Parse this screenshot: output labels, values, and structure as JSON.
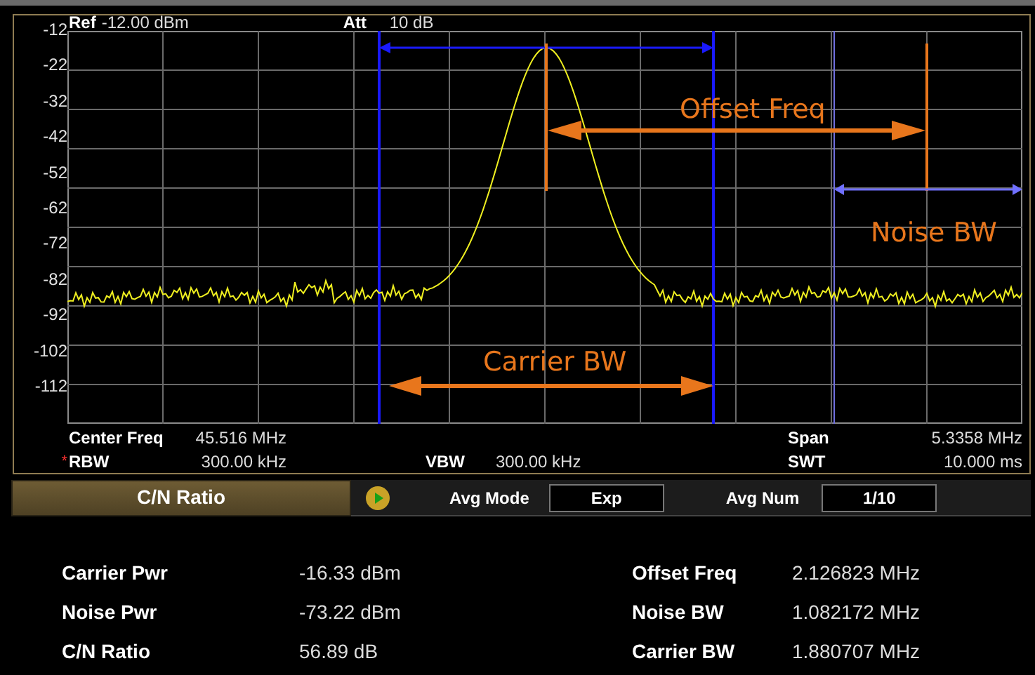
{
  "header": {
    "ref_label": "Ref",
    "ref_value": "-12.00 dBm",
    "att_label": "Att",
    "att_value": "10 dB"
  },
  "y_axis_labels": [
    "-12",
    "-22",
    "-32",
    "-42",
    "-52",
    "-62",
    "-72",
    "-82",
    "-92",
    "-102",
    "-112"
  ],
  "annotations": [
    {
      "kind": "offset",
      "text": "Offset Freq"
    },
    {
      "kind": "noise",
      "text": "Noise BW"
    },
    {
      "kind": "carrier",
      "text": "Carrier BW"
    }
  ],
  "settings_rows": [
    {
      "left": {
        "label": "Center Freq",
        "value": "45.516 MHz"
      },
      "right": {
        "label": "Span",
        "value": "5.3358 MHz"
      }
    },
    {
      "left": {
        "marker": "*",
        "label": "RBW",
        "value": "300.00 kHz"
      },
      "middle": {
        "label": "VBW",
        "value": "300.00 kHz"
      },
      "right": {
        "label": "SWT",
        "value": "10.000 ms"
      }
    }
  ],
  "toolbar": {
    "mode_tab": {
      "label": "C/N Ratio",
      "selected": true
    },
    "avg_mode": {
      "label": "Avg Mode",
      "value": "Exp"
    },
    "avg_num": {
      "label": "Avg Num",
      "value": "1/10"
    }
  },
  "results_left": [
    {
      "label": "Carrier Pwr",
      "value": "-16.33 dBm"
    },
    {
      "label": "Noise Pwr",
      "value": "-73.22 dBm"
    },
    {
      "label": "C/N Ratio",
      "value": "56.89 dB"
    }
  ],
  "results_right": [
    {
      "label": "Offset Freq",
      "value": "2.126823 MHz"
    },
    {
      "label": "Noise BW",
      "value": "1.082172 MHz"
    },
    {
      "label": "Carrier BW",
      "value": "1.880707 MHz"
    }
  ]
}
